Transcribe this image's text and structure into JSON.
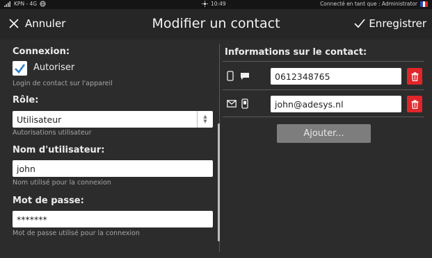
{
  "status_bar": {
    "carrier": "KPN - 4G",
    "time": "10:49",
    "connection": "Connecté en tant que : Administrator",
    "flag_colors": [
      "#2a4bb5",
      "#ffffff",
      "#e0262a"
    ]
  },
  "header": {
    "cancel_label": "Annuler",
    "title": "Modifier un contact",
    "save_label": "Enregistrer"
  },
  "left": {
    "connexion": {
      "label": "Connexion:",
      "checkbox_label": "Autoriser",
      "checked": true,
      "hint": "Login de contact sur l'appareil"
    },
    "role": {
      "label": "Rôle:",
      "value": "Utilisateur",
      "hint": "Autorisations utilisateur"
    },
    "username": {
      "label": "Nom d'utilisateur:",
      "value": "john",
      "hint": "Nom utilisé pour la connexion"
    },
    "password": {
      "label": "Mot de passe:",
      "value": "*******",
      "hint": "Mot de passe utilisé pour la connexion"
    }
  },
  "right": {
    "title": "Informations sur le contact:",
    "contacts": [
      {
        "icons": [
          "phone-icon",
          "sms-icon"
        ],
        "value": "0612348765"
      },
      {
        "icons": [
          "mail-icon",
          "app-icon"
        ],
        "value": "john@adesys.nl"
      }
    ],
    "add_label": "Ajouter..."
  },
  "colors": {
    "accent_blue": "#2b7fcf",
    "delete_red": "#e0262a",
    "background": "#2c2c2c"
  }
}
